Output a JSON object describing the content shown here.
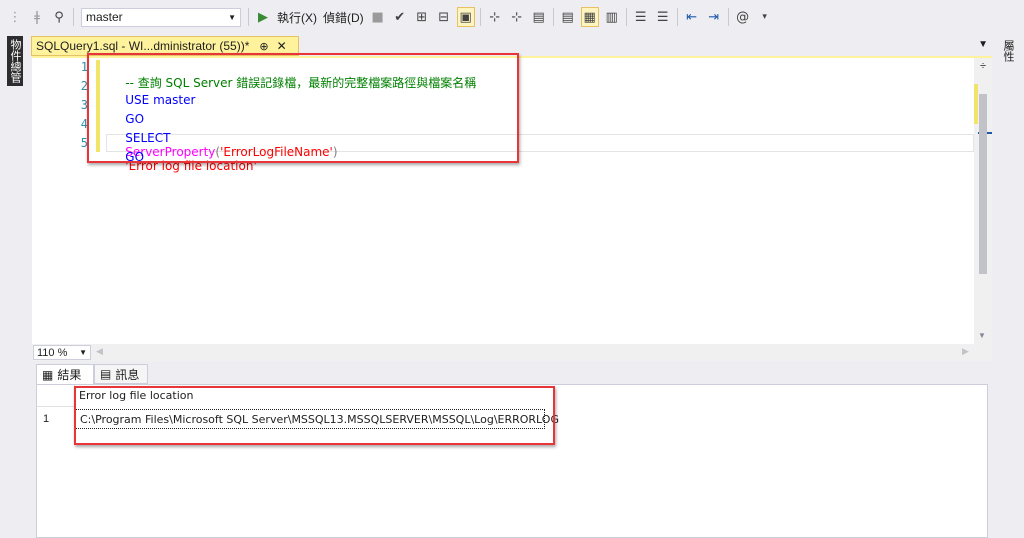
{
  "toolbar": {
    "database": "master",
    "execute_label": "執行(X)",
    "debug_label": "偵錯(D)"
  },
  "left_panel": {
    "object_explorer_label": "物件總管"
  },
  "right_panel": {
    "properties_label": "屬性"
  },
  "document_tab": {
    "title": "SQLQuery1.sql - WI...dministrator (55))*",
    "pin_glyph": "⊕",
    "close_glyph": "✕"
  },
  "editor": {
    "line_numbers": [
      "1",
      "2",
      "3",
      "4",
      "5"
    ],
    "lines": [
      {
        "comment": "-- 查詢 SQL Server 錯誤記錄檔，最新的完整檔案路徑與檔案名稱"
      },
      {
        "kw": "USE",
        "rest": " master"
      },
      {
        "kw": "GO"
      },
      {
        "kw": "SELECT",
        "fn": "ServerProperty",
        "open": "(",
        "arg": "'ErrorLogFileName'",
        "close": ")",
        "alias": "'Error log file location'"
      },
      {
        "kw": "GO"
      }
    ]
  },
  "zoom": {
    "value": "110 %"
  },
  "results_tabs": {
    "results_label": "結果",
    "messages_label": "訊息"
  },
  "results_grid": {
    "columns": [
      "Error log file location"
    ],
    "rows": [
      {
        "num": "1",
        "value": "C:\\Program Files\\Microsoft SQL Server\\MSSQL13.MSSQLSERVER\\MSSQL\\Log\\ERRORLOG"
      }
    ]
  },
  "colors": {
    "accent_tab": "#fff29d",
    "annotation": "#e8353a",
    "comment": "#008000",
    "keyword": "#0000ff",
    "function": "#ff00ff",
    "string": "#ff0000"
  }
}
